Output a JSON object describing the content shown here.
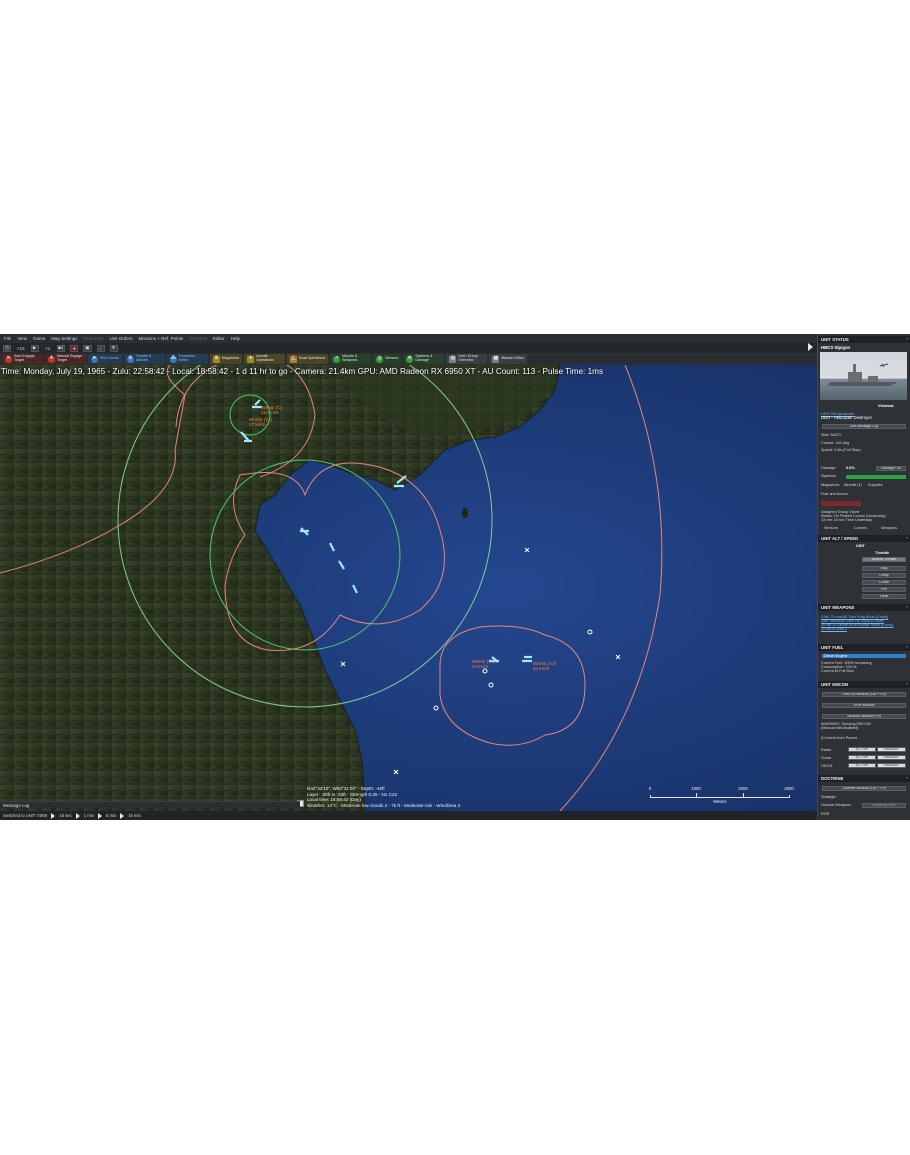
{
  "menu": [
    "File",
    "View",
    "Game",
    "Map Settings",
    "Unit Orders",
    "Missions + Ref. Points",
    "Editor",
    "Help"
  ],
  "menu_disabled": [
    "Scenarios",
    "Contacts"
  ],
  "time_controls": {
    "compression": "15",
    "multiplier": "1"
  },
  "toolbar": {
    "buttons": [
      {
        "label": "Auto Engage Target",
        "icon": "crossed-swords-icon",
        "color": "red"
      },
      {
        "label": "Manual Engage Target",
        "icon": "crosshair-icon",
        "color": "red"
      },
      {
        "label": "Plot Course",
        "icon": "course-icon",
        "color": "blue"
      },
      {
        "label": "Throttle & Altitude",
        "icon": "throttle-icon",
        "color": "blue"
      },
      {
        "label": "Formation Editor",
        "icon": "formation-icon",
        "color": "blue"
      },
      {
        "label": "Magazines",
        "icon": "magazine-icon",
        "color": "olive"
      },
      {
        "label": "Aircraft Operations",
        "icon": "aircraft-icon",
        "color": "olive"
      },
      {
        "label": "Boat Operations",
        "icon": "boat-icon",
        "color": "olive"
      },
      {
        "label": "Mounts & Weapons",
        "icon": "missile-icon",
        "color": "green"
      },
      {
        "label": "Sensors",
        "icon": "radar-icon",
        "color": "green"
      },
      {
        "label": "Systems & Damage",
        "icon": "gear-icon",
        "color": "green"
      },
      {
        "label": "Unit / Group Overview",
        "icon": "unit-overview-icon",
        "color": "grey"
      },
      {
        "label": "Mission Editor",
        "icon": "mission-editor-icon",
        "color": "grey"
      }
    ]
  },
  "hud": {
    "status_line": "Time: Monday, July 19, 1965 - Zulu: 22:58:42 - Local: 18:58:42 - 1 d 11 hr to go - Camera: 21.4km GPU: AMD Radeon RX 6950 XT - AU Count: 113 - Pulse Time: 1ms"
  },
  "map": {
    "contacts": [
      {
        "label": "WAKE (C)",
        "sub": "15.5 m/s"
      },
      {
        "label": "WAKE (V1)",
        "sub": "27 kn/m"
      },
      {
        "label": "WAKE (V2)",
        "sub": "24 kn/m"
      },
      {
        "label": "WAKE (V3)",
        "sub": "24 kn/m"
      }
    ],
    "cursor_info": [
      "N44°32'10\", W63°31'03\" - Depth: -46ft",
      "Layer: -20ft to -33ft - Strength 0.25 - No CZs",
      "Local time: 18:58:42 (Day)",
      "Weather: 14°C - Moderate low clouds 2 - 7k ft - Moderate rain - Wind/Sea 3"
    ],
    "scale": {
      "ticks": [
        "0",
        "1000",
        "2000",
        "3000"
      ],
      "unit": "Meters"
    }
  },
  "message_log": "Message Log",
  "status_bar": {
    "switched": "Switched to UNIT VIEW",
    "steps": [
      "15 sec",
      "1 min",
      "5 min",
      "15 min"
    ]
  },
  "panel": {
    "unit_status": {
      "header": "UNIT STATUS",
      "unit_name": "HMCS Nipigon",
      "side_badge": "Visbenai",
      "class": "DDH 265 Annapolis",
      "type": "DDH - Helicopter Destroyer",
      "message_log_btn": "Unit Message Log",
      "side": "Side: NATO",
      "course": "Course: 140 deg",
      "speed": "Speed: 0 kts (Full Stop)",
      "damage_label": "Damage:",
      "damage_value": "0.0%",
      "damage_btn": "Damage Ctrl",
      "systems_label": "Systems:",
      "magazines": "Magazines",
      "aircraft": "Aircraft (1)",
      "supplies": "Supplies",
      "fuel_ammo": "Fuel and Ammo",
      "assigned": "Assigned Group: None",
      "status_line": "Status: On Plotted Course (Underway)",
      "time_line": "13 min 15 sec Time Underway",
      "tabs": [
        "Sensors",
        "Comms",
        "Weapons"
      ]
    },
    "alt_speed": {
      "header": "UNIT ALT / SPEED",
      "mode": "UNIT",
      "throttle_label": "Throttle",
      "options": [
        "Manual Throttle",
        "Stop",
        "Creep",
        "Cruise",
        "Full",
        "Flank"
      ]
    },
    "weapons": {
      "header": "UNIT WEAPONS",
      "items": [
        "3 Mk 70 mm/50 Twin Frag Burst [3 mds]",
        "1Mx 76mm/50 Twin HE Burst [2 mds]",
        "1x Mk 10 Limbo ASW Mortar Salvo [3 mds]",
        "1x Mk44 Mod 1"
      ]
    },
    "fuel": {
      "header": "UNIT FUEL",
      "selected": "Diesel Engine",
      "lines": [
        "Current Fuel: 100% remaining",
        "Consumption: 100 l/s",
        "Current At Full Burn"
      ]
    },
    "emcon": {
      "header": "UNIT EMCON",
      "btn1": "EMCON Window (Ctrl + F9)",
      "btn2": "RFM Window",
      "btn3": "Sensors Window (F9)",
      "warning1": "WARNING: Obeying EMCON",
      "warning2": "(Manual edit disabled)",
      "inherit": "Inherit from Parent",
      "rows": [
        {
          "name": "Radar",
          "a": "ACTIVE",
          "b": "PASSIVE"
        },
        {
          "name": "Sonar",
          "a": "ACTIVE",
          "b": "PASSIVE"
        },
        {
          "name": "OECM",
          "a": "ACTIVE",
          "b": "PASSIVE"
        }
      ]
    },
    "doctrine": {
      "header": "DOCTRINE",
      "btn": "Doctrine Window (Ctrl + F9)",
      "strategic": "Strategic",
      "nuclear": "Nuclear Weapons",
      "nuclear_value": "Weapons Free",
      "roe": "ROE"
    }
  },
  "colors": {
    "land_dark": "#1f2a1a",
    "land_light": "#3c4a2c",
    "sea": "#1d3b7a",
    "range_orange": "#e8857a",
    "range_green": "#4ec96a",
    "unit_cyan": "#9fe8ff"
  }
}
